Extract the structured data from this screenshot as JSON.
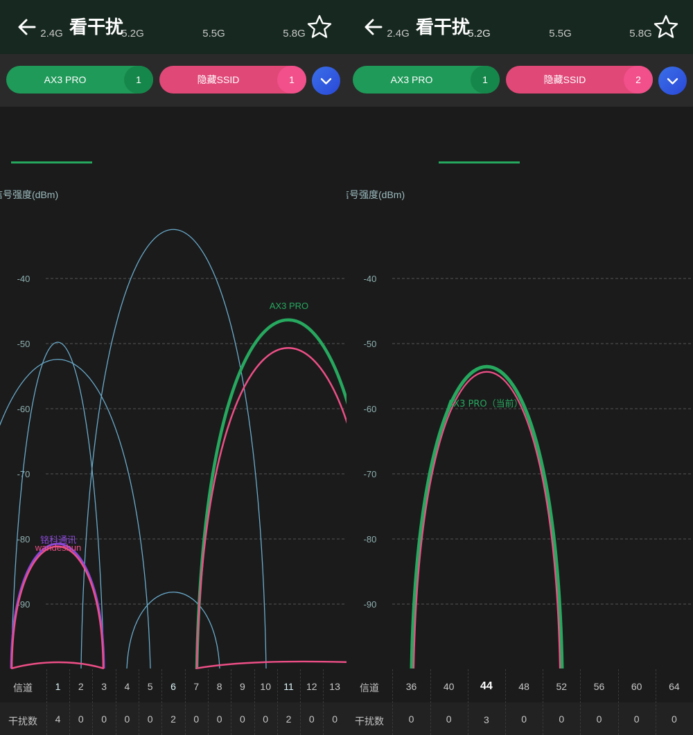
{
  "screens": [
    {
      "title": "看干扰",
      "filter": {
        "primary_label": "AX3 PRO",
        "primary_count": "1",
        "secondary_label": "隐藏SSID",
        "secondary_count": "1"
      },
      "tabs": [
        "2.4G",
        "5.2G",
        "5.5G",
        "5.8G"
      ],
      "active_tab": 0,
      "channel_label": "信道",
      "interference_label": "干扰数",
      "channels": [
        "1",
        "2",
        "3",
        "4",
        "5",
        "6",
        "7",
        "8",
        "9",
        "10",
        "11",
        "12",
        "13"
      ],
      "interference": [
        "4",
        "0",
        "0",
        "0",
        "0",
        "2",
        "0",
        "0",
        "0",
        "0",
        "2",
        "0",
        "0"
      ],
      "highlighted_channels": [
        "1",
        "6",
        "11"
      ],
      "chart_data": {
        "type": "line",
        "ylabel": "信号强度(dBm)",
        "y_ticks": [
          -40,
          -50,
          -60,
          -70,
          -80,
          -90
        ],
        "grid": true,
        "networks": [
          {
            "name": "AX3 PRO",
            "channel": 11,
            "peak_dbm": -45,
            "color": "#27a85f"
          },
          {
            "name": "",
            "channel": 11,
            "peak_dbm": -49,
            "color": "#ee4f87"
          },
          {
            "name": "铭科通讯",
            "channel": 2,
            "peak_dbm": -81,
            "color": "#8a48d8"
          },
          {
            "name": "wandeshun",
            "channel": 2,
            "peak_dbm": -82,
            "color": "#ee4f87"
          },
          {
            "name": "",
            "channel": 6,
            "peak_dbm": -31,
            "color": "#6aaccd"
          },
          {
            "name": "",
            "channel": 2,
            "peak_dbm": -48,
            "color": "#6aaccd"
          },
          {
            "name": "",
            "channel": 2,
            "peak_dbm": -52,
            "color": "#6aaccd"
          },
          {
            "name": "",
            "channel": 6,
            "peak_dbm": -89,
            "color": "#6aaccd"
          }
        ]
      }
    },
    {
      "title": "看干扰",
      "filter": {
        "primary_label": "AX3 PRO",
        "primary_count": "1",
        "secondary_label": "隐藏SSID",
        "secondary_count": "2"
      },
      "tabs": [
        "2.4G",
        "5.2G",
        "5.5G",
        "5.8G"
      ],
      "active_tab": 1,
      "channel_label": "信道",
      "interference_label": "干扰数",
      "channels": [
        "36",
        "40",
        "44",
        "48",
        "52",
        "56",
        "60",
        "64"
      ],
      "interference": [
        "0",
        "0",
        "3",
        "0",
        "0",
        "0",
        "0",
        "0"
      ],
      "highlighted_channels": [
        "44"
      ],
      "chart_data": {
        "type": "line",
        "ylabel": "信号强度(dBm)",
        "y_ticks": [
          -40,
          -50,
          -60,
          -70,
          -80,
          -90
        ],
        "grid": true,
        "networks": [
          {
            "name": "AX3 PRO（当前）",
            "channel": 44,
            "peak_dbm": -60,
            "color": "#27a85f"
          },
          {
            "name": "",
            "channel": 44,
            "peak_dbm": -61,
            "color": "#ee4f87"
          }
        ]
      }
    }
  ]
}
